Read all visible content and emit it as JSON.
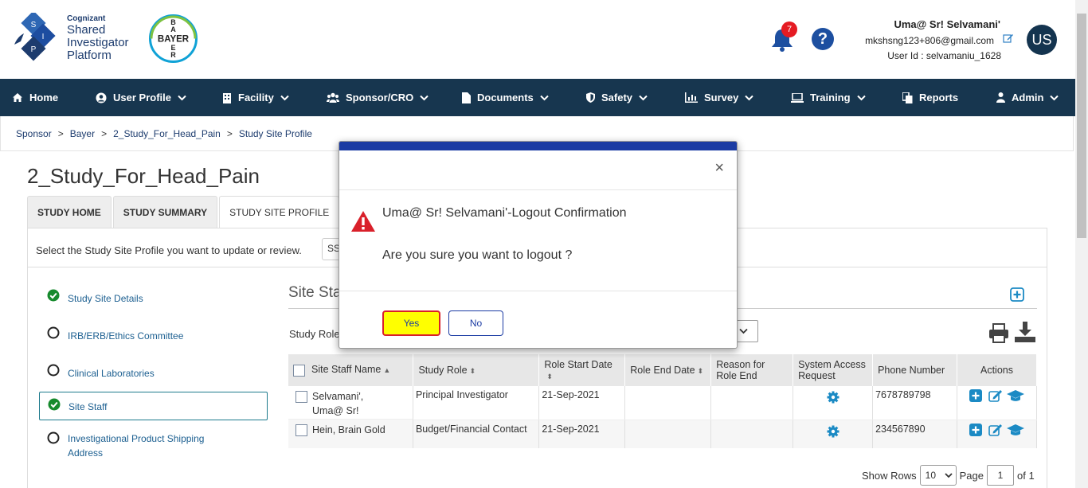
{
  "header": {
    "logo": {
      "sip_letters": [
        "S",
        "I",
        "P"
      ],
      "brand": "Cognizant",
      "lines": [
        "Shared",
        "Investigator",
        "Platform"
      ],
      "sponsor_logo": "BAYER"
    },
    "notifications": {
      "count": "7",
      "icon": "bell-icon"
    },
    "help": {
      "label": "?",
      "icon": "help-icon"
    },
    "user": {
      "name": "Uma@ Sr! Selvamani'",
      "email": "mkshsng123+806@gmail.com",
      "user_id": "User Id : selvamaniu_1628",
      "initials": "US"
    }
  },
  "nav": {
    "items": [
      {
        "label": "Home",
        "icon": "home-icon",
        "dropdown": false
      },
      {
        "label": "User Profile",
        "icon": "user-circle-icon",
        "dropdown": true
      },
      {
        "label": "Facility",
        "icon": "building-icon",
        "dropdown": true
      },
      {
        "label": "Sponsor/CRO",
        "icon": "users-icon",
        "dropdown": true
      },
      {
        "label": "Documents",
        "icon": "file-icon",
        "dropdown": true
      },
      {
        "label": "Safety",
        "icon": "shield-icon",
        "dropdown": true
      },
      {
        "label": "Survey",
        "icon": "bar-chart-icon",
        "dropdown": true
      },
      {
        "label": "Training",
        "icon": "laptop-icon",
        "dropdown": true
      },
      {
        "label": "Reports",
        "icon": "copy-icon",
        "dropdown": false
      },
      {
        "label": "Admin",
        "icon": "user-icon",
        "dropdown": true
      }
    ]
  },
  "breadcrumb": [
    "Sponsor",
    ">",
    "Bayer",
    ">",
    "2_Study_For_Head_Pain",
    ">",
    "Study Site Profile"
  ],
  "page": {
    "title": "2_Study_For_Head_Pain",
    "tabs": [
      "STUDY HOME",
      "STUDY SUMMARY",
      "STUDY SITE PROFILE"
    ],
    "select_hint": "Select the Study Site Profile you want to update or review.",
    "select_value": "SS"
  },
  "sidebar": {
    "items": [
      {
        "label": "Study Site Details",
        "state": "done"
      },
      {
        "label": "IRB/ERB/Ethics Committee",
        "state": "empty"
      },
      {
        "label": "Clinical Laboratories",
        "state": "empty"
      },
      {
        "label": "Site Staff",
        "state": "done-active"
      },
      {
        "label": "Investigational Product Shipping Address",
        "state": "empty"
      }
    ]
  },
  "section": {
    "title": "Site Sta",
    "study_role_label": "Study Role"
  },
  "table": {
    "headers": [
      "Site Staff Name",
      "Study Role",
      "Role Start Date",
      "Role End Date",
      "Reason for Role End",
      "System Access Request",
      "Phone Number",
      "Actions"
    ],
    "rows": [
      {
        "name": "Selvamani', Uma@ Sr!",
        "role": "Principal Investigator",
        "start": "21-Sep-2021",
        "end": "",
        "reason": "",
        "phone": "7678789798"
      },
      {
        "name": "Hein, Brain Gold",
        "role": "Budget/Financial Contact",
        "start": "21-Sep-2021",
        "end": "",
        "reason": "",
        "phone": "234567890"
      }
    ]
  },
  "pager": {
    "show_rows_label": "Show Rows",
    "rows_value": "10",
    "page_label": "Page",
    "page_value": "1",
    "of_label": "of 1"
  },
  "modal": {
    "title": "Uma@ Sr! Selvamani'-Logout Confirmation",
    "message": "Are you sure you want to logout ?",
    "yes_label": "Yes",
    "no_label": "No",
    "close_label": "×",
    "warn_icon": "warning-icon"
  },
  "colors": {
    "nav_bg": "#17364f",
    "modal_top": "#1b3ba3",
    "yes_bg": "#ffff00",
    "yes_border": "#d9202a",
    "badge": "#e51b23"
  }
}
